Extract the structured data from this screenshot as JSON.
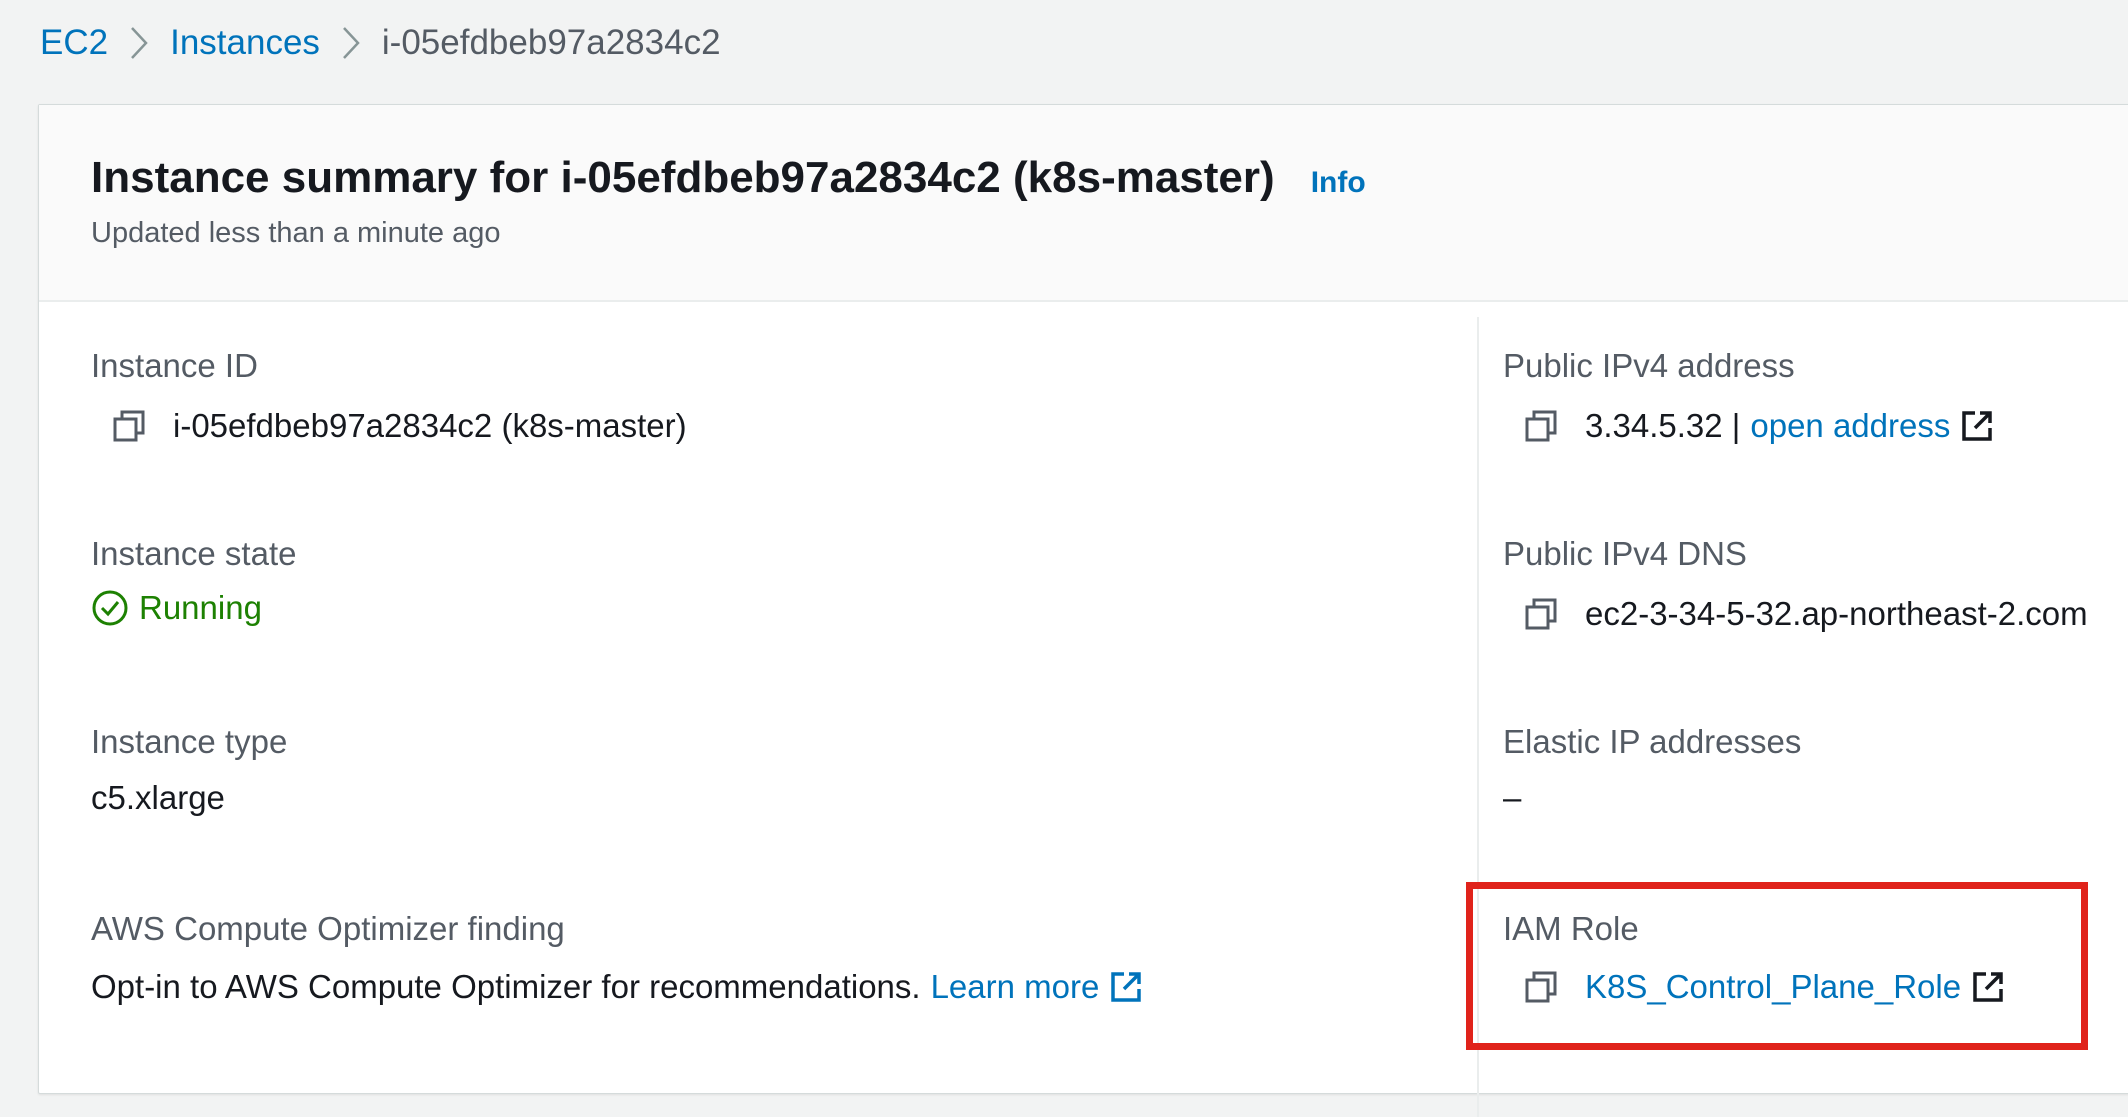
{
  "breadcrumb": {
    "items": [
      {
        "label": "EC2"
      },
      {
        "label": "Instances"
      },
      {
        "label": "i-05efdbeb97a2834c2"
      }
    ]
  },
  "summary": {
    "title": "Instance summary for i-05efdbeb97a2834c2 (k8s-master)",
    "info_label": "Info",
    "updated": "Updated less than a minute ago"
  },
  "left_fields": {
    "instance_id": {
      "label": "Instance ID",
      "value": "i-05efdbeb97a2834c2 (k8s-master)"
    },
    "instance_state": {
      "label": "Instance state",
      "value": "Running"
    },
    "instance_type": {
      "label": "Instance type",
      "value": "c5.xlarge"
    },
    "compute_optimizer": {
      "label": "AWS Compute Optimizer finding",
      "value": "Opt-in to AWS Compute Optimizer for recommendations.",
      "link": "Learn more"
    }
  },
  "right_fields": {
    "public_ipv4": {
      "label": "Public IPv4 address",
      "value": "3.34.5.32 |",
      "link": "open address"
    },
    "public_dns": {
      "label": "Public IPv4 DNS",
      "value": "ec2-3-34-5-32.ap-northeast-2.com"
    },
    "elastic_ip": {
      "label": "Elastic IP addresses",
      "value": "–"
    },
    "iam_role": {
      "label": "IAM Role",
      "link": "K8S_Control_Plane_Role"
    }
  },
  "colors": {
    "link": "#0073bb",
    "running": "#1d8102",
    "highlight": "#e0231b"
  },
  "icons": {
    "breadcrumb_separator": "chevron-right-icon",
    "copy": "copy-icon",
    "external": "external-link-icon",
    "status": "check-circle-icon"
  }
}
